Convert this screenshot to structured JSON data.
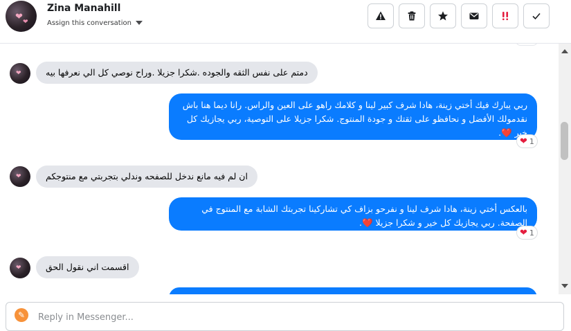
{
  "header": {
    "contact_name": "Zina Manahill",
    "assign_label": "Assign this conversation",
    "toolbar": [
      {
        "name": "report-spam-button",
        "icon": "warning-icon"
      },
      {
        "name": "delete-button",
        "icon": "trash-icon"
      },
      {
        "name": "star-button",
        "icon": "star-icon"
      },
      {
        "name": "mark-unread-button",
        "icon": "envelope-icon"
      },
      {
        "name": "flag-button",
        "icon": "exclamation-icon"
      },
      {
        "name": "mark-done-button",
        "icon": "check-icon"
      }
    ]
  },
  "messages": [
    {
      "direction": "in",
      "text": "دمتم على نفس الثقه والجوده .شكرا جزيلا .وراح نوصي كل الي نعرفها بيه"
    },
    {
      "direction": "out",
      "lines": [
        "ربي يبارك فيك أختي زينة، هادا شرف كبير لينا و كلامك راهو على العين والراس. رانا ديما هنا باش",
        "نقدمولك الأفضل و نحافظو على ثقتك و جودة المنتوج. شكرا جزيلا على التوصية، ربي يجازيك كل",
        "خير ❤️."
      ],
      "reaction": {
        "emoji": "❤️",
        "count": "1"
      }
    },
    {
      "direction": "in",
      "text": "ان لم فيه مانع ندخل للصفحه وندلي بتجربتي مع منتوجكم"
    },
    {
      "direction": "out",
      "lines": [
        "بالعكس أختي زينة، هادا شرف لينا و نفرحو بزاف كي تشاركينا تجربتك الشابة مع المنتوج في",
        "الصفحة. ربي يجازيك كل خير و شكرا جزيلا ❤️."
      ],
      "reaction": {
        "emoji": "❤️",
        "count": "1"
      }
    },
    {
      "direction": "in",
      "text": "اقسمت اني نقول الحق"
    }
  ],
  "reply": {
    "placeholder": "Reply in Messenger..."
  },
  "colors": {
    "outgoing_bubble": "#0a7cff",
    "incoming_bubble": "#e4e6eb",
    "flag_red": "#e41e3f"
  }
}
